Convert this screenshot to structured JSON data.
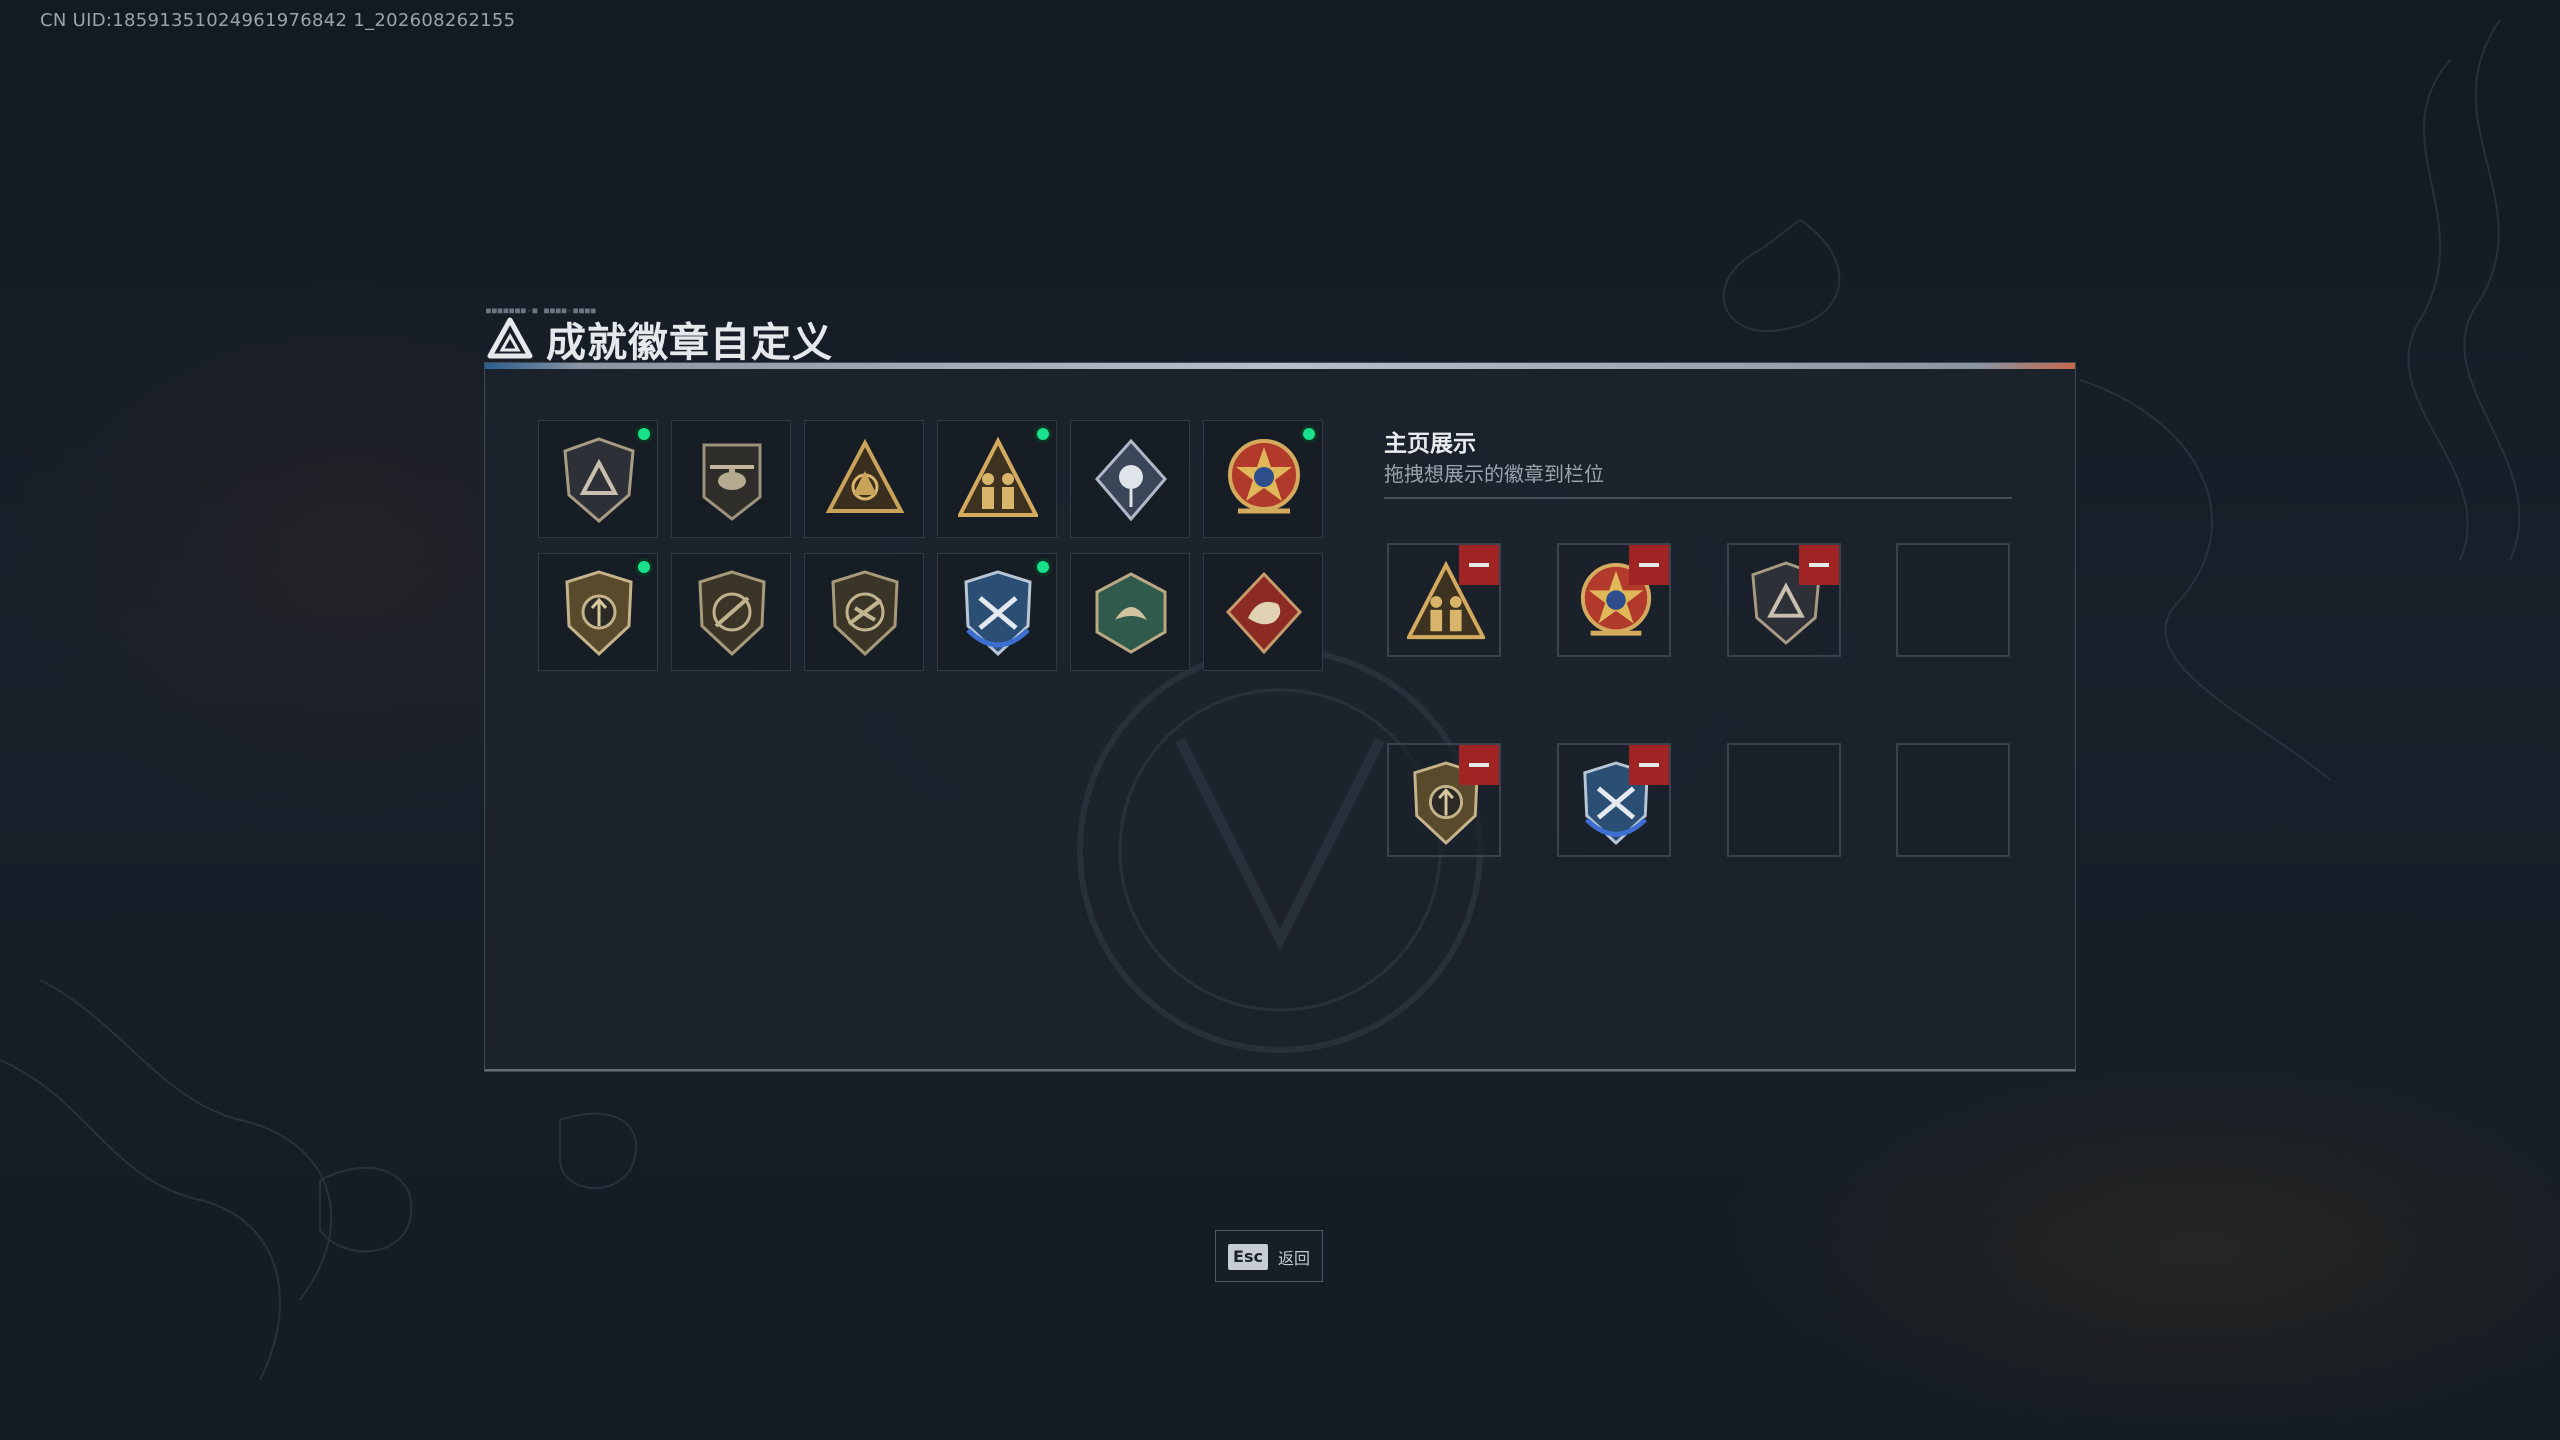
{
  "uid_text": "CN UID:18591351024961976842 1_202608262155",
  "header": {
    "title": "成就徽章自定义",
    "deco_text": "■■■■■■■-■ ■■■■-■■■■",
    "title_icon": "delta-triangle-icon"
  },
  "colors": {
    "accent_green": "#18e08b",
    "remove_red": "#a02424",
    "panel_bg": "#1c232d",
    "gold": "#c9a35a"
  },
  "badges": [
    {
      "icon": "shield-delta-badge",
      "new": true
    },
    {
      "icon": "helicopter-badge",
      "new": false
    },
    {
      "icon": "tri-emblem-badge",
      "new": false
    },
    {
      "icon": "soldiers-triangle-badge",
      "new": true
    },
    {
      "icon": "rose-diamond-badge",
      "new": false
    },
    {
      "icon": "star-medal-badge",
      "new": true
    },
    {
      "icon": "shield-arrows-badge",
      "new": true
    },
    {
      "icon": "shield-rifle-badge-1",
      "new": false
    },
    {
      "icon": "shield-rifle-badge-2",
      "new": false
    },
    {
      "icon": "blue-cross-shield-badge",
      "new": true
    },
    {
      "icon": "green-hex-creature-badge",
      "new": false
    },
    {
      "icon": "red-diamond-beast-badge",
      "new": false
    }
  ],
  "showcase": {
    "title": "主页展示",
    "subtitle": "拖拽想展示的徽章到栏位",
    "slots": [
      {
        "icon": "soldiers-triangle-badge",
        "filled": true
      },
      {
        "icon": "star-medal-badge",
        "filled": true
      },
      {
        "icon": "shield-delta-badge",
        "filled": true
      },
      {
        "icon": "",
        "filled": false
      },
      {
        "icon": "shield-arrows-badge",
        "filled": true
      },
      {
        "icon": "blue-cross-shield-badge",
        "filled": true
      },
      {
        "icon": "",
        "filled": false
      },
      {
        "icon": "",
        "filled": false
      }
    ]
  },
  "footer": {
    "esc_key": "Esc",
    "esc_label": "返回"
  }
}
